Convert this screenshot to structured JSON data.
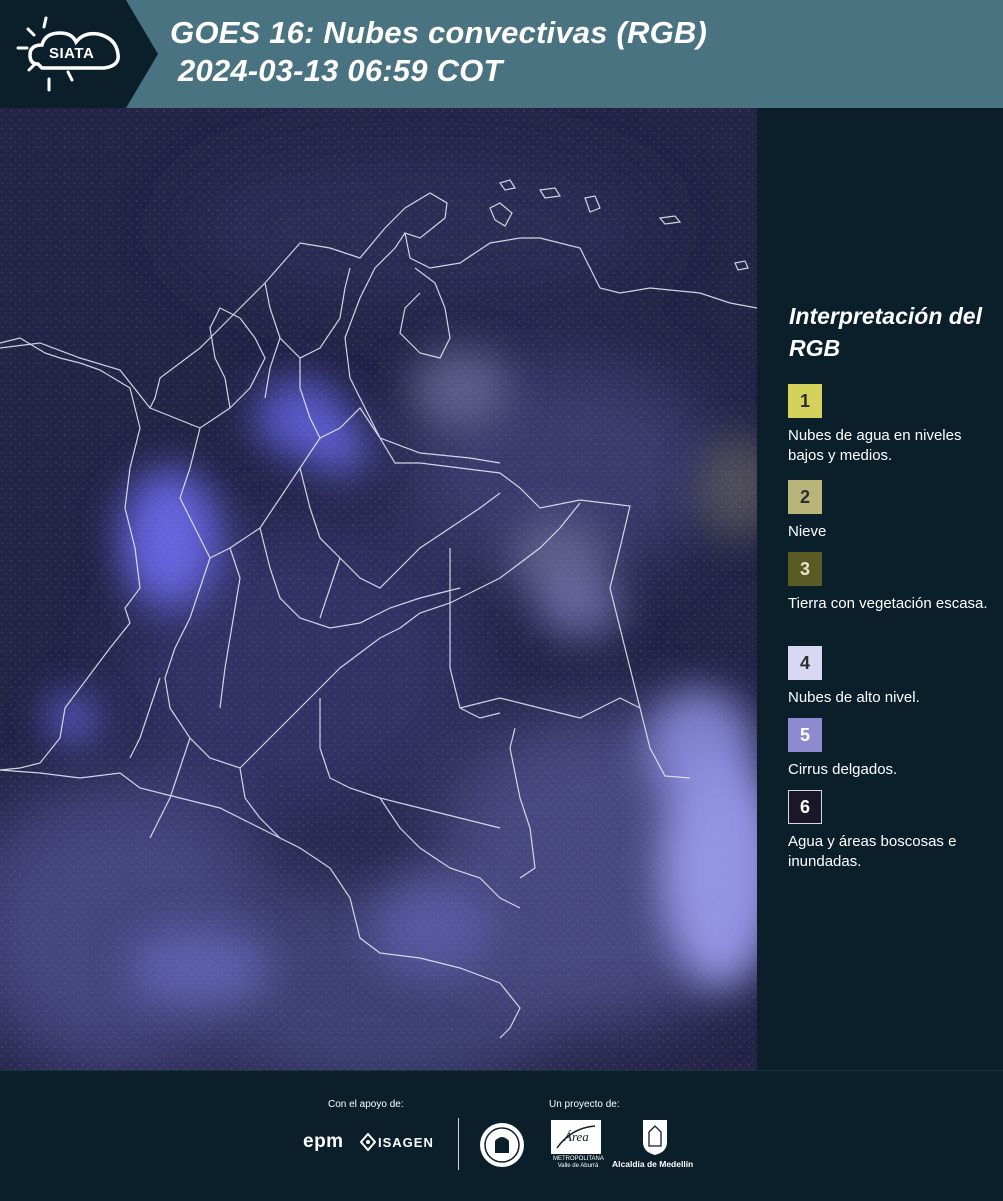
{
  "header": {
    "logo_text": "SIATA",
    "title_line1": "GOES 16: Nubes convectivas (RGB)",
    "title_line2": "2024-03-13 06:59 COT",
    "background_color": "#4a7382"
  },
  "map": {
    "type": "satellite RGB composite",
    "background_color": "#242447"
  },
  "legend": {
    "title": "Interpretación del RGB",
    "items": [
      {
        "number": "1",
        "label": "Nubes de agua en niveles bajos y medios.",
        "color": "#d4d25a"
      },
      {
        "number": "2",
        "label": "Nieve",
        "color": "#b8b47a"
      },
      {
        "number": "3",
        "label": "Tierra con vegetación escasa.",
        "color": "#5a5a24"
      },
      {
        "number": "4",
        "label": "Nubes de alto nivel.",
        "color": "#d8d8f2"
      },
      {
        "number": "5",
        "label": "Cirrus delgados.",
        "color": "#8e8ad0"
      },
      {
        "number": "6",
        "label": "Agua y áreas boscosas e inundadas.",
        "color": "#1a1828"
      }
    ]
  },
  "footer": {
    "support_label": "Con el apoyo de:",
    "project_label": "Un proyecto de:",
    "sponsors": [
      "epm",
      "ISAGEN"
    ],
    "partners": {
      "amva_logo_text": "Área",
      "amva_caption": "METROPOLITANA Valle de Aburrá",
      "medellin": "Alcaldía de Medellín"
    }
  }
}
